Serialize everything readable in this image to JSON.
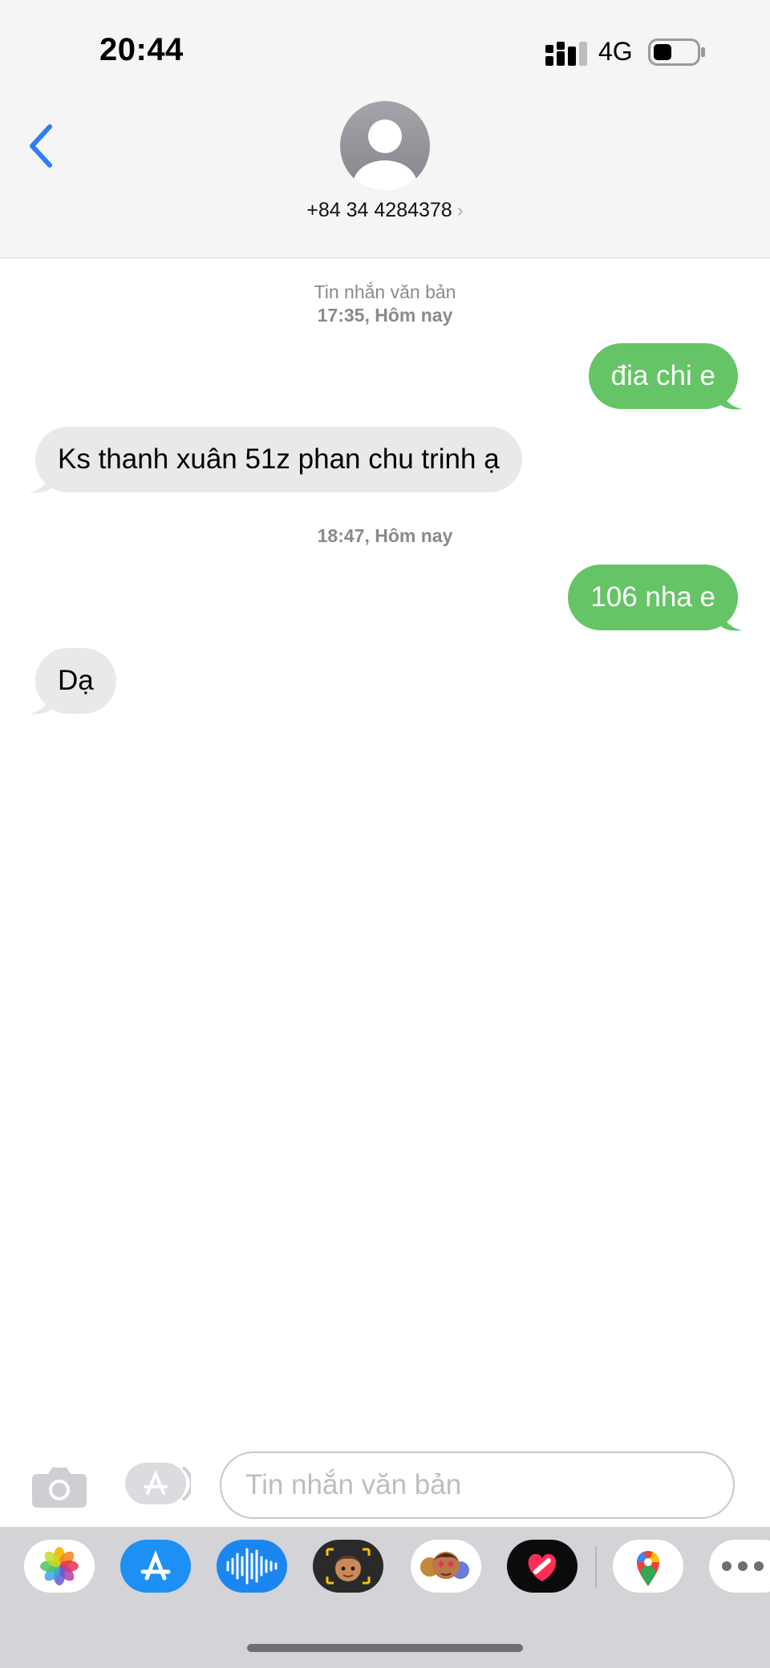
{
  "status_bar": {
    "time": "20:44",
    "network": "4G"
  },
  "header": {
    "contact": "+84 34 4284378",
    "chevron": "›"
  },
  "colors": {
    "accent": "#2f7cf6",
    "outgoing_bubble": "#65c466",
    "incoming_bubble": "#e9e9eb"
  },
  "timestamps": [
    {
      "line1": "Tin nhắn văn bản",
      "line2_time": "17:35,",
      "line2_day": "Hôm nay"
    },
    {
      "line1": "",
      "line2_time": "18:47,",
      "line2_day": "Hôm nay"
    }
  ],
  "messages": [
    {
      "direction": "out",
      "text": "đia chi e"
    },
    {
      "direction": "in",
      "text": "Ks thanh xuân 51z phan chu trinh ạ"
    },
    {
      "direction": "out",
      "text": "106 nha e"
    },
    {
      "direction": "in",
      "text": "Dạ"
    }
  ],
  "compose": {
    "placeholder": "Tin nhắn văn bản"
  },
  "app_tray": [
    "photos-icon",
    "app-store-icon",
    "audio-message-icon",
    "memoji-icon",
    "animoji-stickers-icon",
    "digital-touch-icon",
    "google-maps-icon",
    "more-icon"
  ]
}
